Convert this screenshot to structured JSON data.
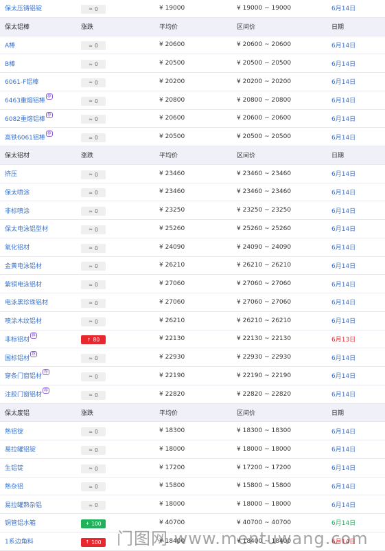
{
  "columns": {
    "change": "涨跌",
    "avg": "平均价",
    "range": "区间价",
    "date": "日期"
  },
  "sections": [
    {
      "title": "",
      "rows": [
        {
          "name": "保太压铸铝锭",
          "change": "0",
          "dir": "flat",
          "avg": "¥ 19000",
          "range": "¥ 19000 ~ 19000",
          "date": "6月14日"
        }
      ]
    },
    {
      "title": "保太铝棒",
      "rows": [
        {
          "name": "A棒",
          "change": "0",
          "dir": "flat",
          "avg": "¥ 20600",
          "range": "¥ 20600 ~ 20600",
          "date": "6月14日"
        },
        {
          "name": "B棒",
          "change": "0",
          "dir": "flat",
          "avg": "¥ 20500",
          "range": "¥ 20500 ~ 20500",
          "date": "6月14日"
        },
        {
          "name": "6061-F铝棒",
          "change": "0",
          "dir": "flat",
          "avg": "¥ 20200",
          "range": "¥ 20200 ~ 20200",
          "date": "6月14日"
        },
        {
          "name": "6463重熔铝棒",
          "sup": "荐",
          "change": "0",
          "dir": "flat",
          "avg": "¥ 20800",
          "range": "¥ 20800 ~ 20800",
          "date": "6月14日"
        },
        {
          "name": "6082重熔铝棒",
          "sup": "荐",
          "change": "0",
          "dir": "flat",
          "avg": "¥ 20600",
          "range": "¥ 20600 ~ 20600",
          "date": "6月14日"
        },
        {
          "name": "高铁6061铝棒",
          "sup": "荐",
          "change": "0",
          "dir": "flat",
          "avg": "¥ 20500",
          "range": "¥ 20500 ~ 20500",
          "date": "6月14日"
        }
      ]
    },
    {
      "title": "保太铝材",
      "rows": [
        {
          "name": "挤压",
          "change": "0",
          "dir": "flat",
          "avg": "¥ 23460",
          "range": "¥ 23460 ~ 23460",
          "date": "6月14日"
        },
        {
          "name": "保太喷涂",
          "change": "0",
          "dir": "flat",
          "avg": "¥ 23460",
          "range": "¥ 23460 ~ 23460",
          "date": "6月14日"
        },
        {
          "name": "非标喷涂",
          "change": "0",
          "dir": "flat",
          "avg": "¥ 23250",
          "range": "¥ 23250 ~ 23250",
          "date": "6月14日"
        },
        {
          "name": "保太电泳铝型材",
          "change": "0",
          "dir": "flat",
          "avg": "¥ 25260",
          "range": "¥ 25260 ~ 25260",
          "date": "6月14日"
        },
        {
          "name": "氧化铝材",
          "change": "0",
          "dir": "flat",
          "avg": "¥ 24090",
          "range": "¥ 24090 ~ 24090",
          "date": "6月14日"
        },
        {
          "name": "金黄电泳铝材",
          "change": "0",
          "dir": "flat",
          "avg": "¥ 26210",
          "range": "¥ 26210 ~ 26210",
          "date": "6月14日"
        },
        {
          "name": "紫铜电泳铝材",
          "change": "0",
          "dir": "flat",
          "avg": "¥ 27060",
          "range": "¥ 27060 ~ 27060",
          "date": "6月14日"
        },
        {
          "name": "电泳黑珍珠铝材",
          "change": "0",
          "dir": "flat",
          "avg": "¥ 27060",
          "range": "¥ 27060 ~ 27060",
          "date": "6月14日"
        },
        {
          "name": "喷涂木纹铝材",
          "change": "0",
          "dir": "flat",
          "avg": "¥ 26210",
          "range": "¥ 26210 ~ 26210",
          "date": "6月14日"
        },
        {
          "name": "非标铝材",
          "sup": "荐",
          "change": "80",
          "dir": "up",
          "avg": "¥ 22130",
          "range": "¥ 22130 ~ 22130",
          "date": "6月13日",
          "date_color": "red"
        },
        {
          "name": "国标铝材",
          "sup": "荐",
          "change": "0",
          "dir": "flat",
          "avg": "¥ 22930",
          "range": "¥ 22930 ~ 22930",
          "date": "6月14日"
        },
        {
          "name": "穿条门窗铝材",
          "sup": "荐",
          "change": "0",
          "dir": "flat",
          "avg": "¥ 22190",
          "range": "¥ 22190 ~ 22190",
          "date": "6月14日"
        },
        {
          "name": "注胶门窗铝材",
          "sup": "荐",
          "change": "0",
          "dir": "flat",
          "avg": "¥ 22820",
          "range": "¥ 22820 ~ 22820",
          "date": "6月14日"
        }
      ]
    },
    {
      "title": "保太废铝",
      "rows": [
        {
          "name": "熟铝锭",
          "change": "0",
          "dir": "flat",
          "avg": "¥ 18300",
          "range": "¥ 18300 ~ 18300",
          "date": "6月14日"
        },
        {
          "name": "易拉罐铝锭",
          "change": "0",
          "dir": "flat",
          "avg": "¥ 18000",
          "range": "¥ 18000 ~ 18000",
          "date": "6月14日"
        },
        {
          "name": "生铝锭",
          "change": "0",
          "dir": "flat",
          "avg": "¥ 17200",
          "range": "¥ 17200 ~ 17200",
          "date": "6月14日"
        },
        {
          "name": "熟杂铝",
          "change": "0",
          "dir": "flat",
          "avg": "¥ 15800",
          "range": "¥ 15800 ~ 15800",
          "date": "6月14日"
        },
        {
          "name": "易拉罐熟杂铝",
          "change": "0",
          "dir": "flat",
          "avg": "¥ 18000",
          "range": "¥ 18000 ~ 18000",
          "date": "6月14日"
        },
        {
          "name": "铜管铝水箱",
          "change": "100",
          "dir": "gain",
          "avg": "¥ 40700",
          "range": "¥ 40700 ~ 40700",
          "date": "6月14日",
          "date_color": "green"
        },
        {
          "name": "1系边角料",
          "change": "100",
          "dir": "up",
          "avg": "¥ 18400",
          "range": "¥ 18400 ~ 18400",
          "date": "6月14日",
          "date_color": "red"
        }
      ]
    }
  ],
  "icons": {
    "flat": "≈",
    "up": "↑",
    "gain": "+"
  },
  "colors": {
    "link": "#3a73c9",
    "up": "#e8262d",
    "gain": "#20b15a",
    "header_bg": "#f0f0f8"
  },
  "watermark": "门图网 www.mentuwang.com"
}
